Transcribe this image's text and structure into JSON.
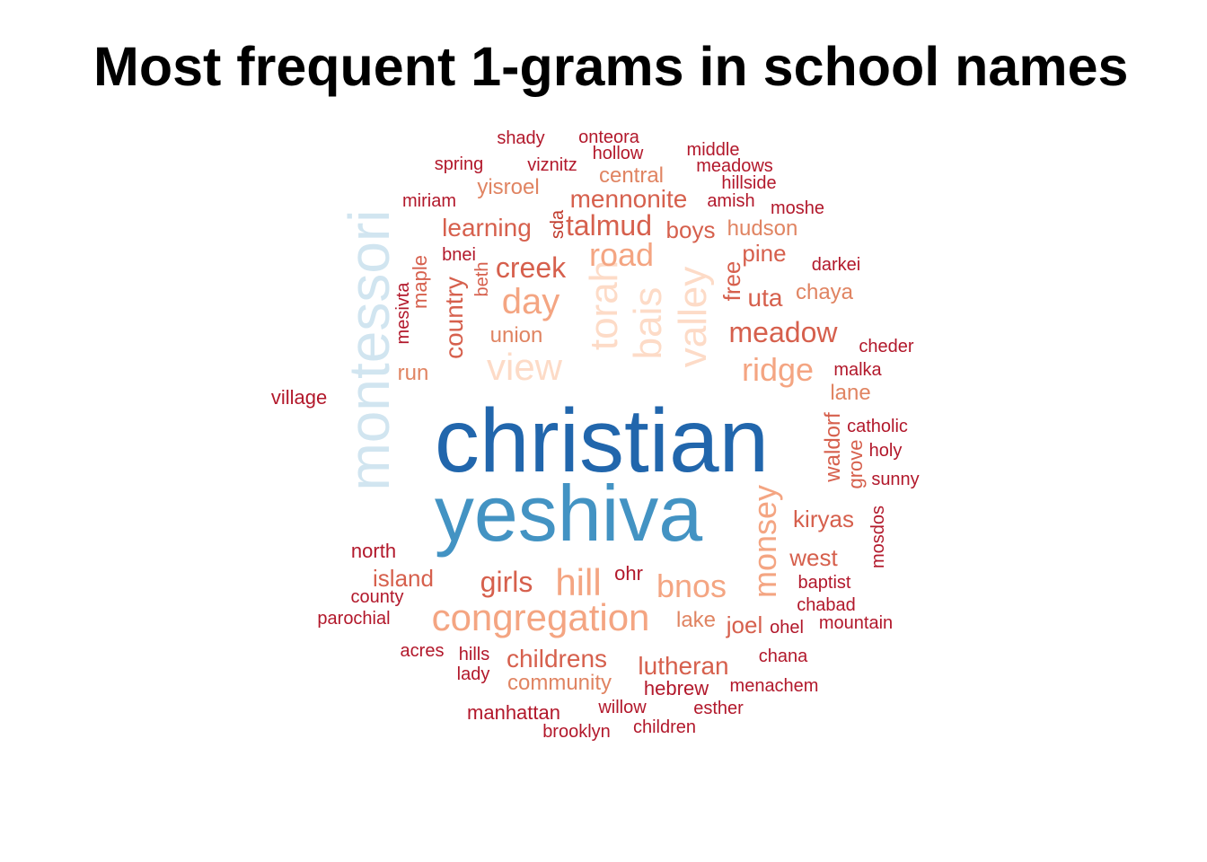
{
  "chart_data": {
    "type": "wordcloud",
    "title": "Most frequent 1-grams in school names",
    "color_scale": "RdBu (red = less frequent, blue = most frequent)",
    "words": [
      {
        "word": "christian",
        "color": "#2166ac"
      },
      {
        "word": "yeshiva",
        "color": "#4393c3"
      },
      {
        "word": "montessori",
        "color": "#d1e5f0"
      },
      {
        "word": "view",
        "color": "#fddbc7"
      },
      {
        "word": "torah",
        "color": "#fddbc7"
      },
      {
        "word": "bais",
        "color": "#fddbc7"
      },
      {
        "word": "valley",
        "color": "#fddbc7"
      },
      {
        "word": "congregation",
        "color": "#f4a582"
      },
      {
        "word": "hill",
        "color": "#f4a582"
      },
      {
        "word": "day",
        "color": "#f4a582"
      },
      {
        "word": "road",
        "color": "#f4a582"
      },
      {
        "word": "ridge",
        "color": "#f4a582"
      },
      {
        "word": "bnos",
        "color": "#f4a582"
      },
      {
        "word": "monsey",
        "color": "#f4a582"
      },
      {
        "word": "girls",
        "color": "#d6604d"
      },
      {
        "word": "creek",
        "color": "#d6604d"
      },
      {
        "word": "meadow",
        "color": "#d6604d"
      },
      {
        "word": "talmud",
        "color": "#d6604d"
      },
      {
        "word": "mennonite",
        "color": "#d6604d"
      },
      {
        "word": "learning",
        "color": "#d6604d"
      },
      {
        "word": "country",
        "color": "#d6604d"
      },
      {
        "word": "childrens",
        "color": "#d6604d"
      },
      {
        "word": "lutheran",
        "color": "#d6604d"
      },
      {
        "word": "uta",
        "color": "#d6604d"
      },
      {
        "word": "island",
        "color": "#d6604d"
      },
      {
        "word": "west",
        "color": "#d6604d"
      },
      {
        "word": "kiryas",
        "color": "#d6604d"
      },
      {
        "word": "joel",
        "color": "#d6604d"
      },
      {
        "word": "community",
        "color": "#e08462"
      },
      {
        "word": "waldorf",
        "color": "#d6604d"
      },
      {
        "word": "boys",
        "color": "#d6604d"
      },
      {
        "word": "free",
        "color": "#d6604d"
      },
      {
        "word": "pine",
        "color": "#d6604d"
      },
      {
        "word": "hudson",
        "color": "#e08462"
      },
      {
        "word": "central",
        "color": "#e08462"
      },
      {
        "word": "yisroel",
        "color": "#e08462"
      },
      {
        "word": "union",
        "color": "#e08462"
      },
      {
        "word": "chaya",
        "color": "#e08462"
      },
      {
        "word": "lane",
        "color": "#e08462"
      },
      {
        "word": "lake",
        "color": "#e08462"
      },
      {
        "word": "run",
        "color": "#e08462"
      },
      {
        "word": "grove",
        "color": "#d6604d"
      },
      {
        "word": "hebrew",
        "color": "#b2182b"
      },
      {
        "word": "maple",
        "color": "#d6604d"
      },
      {
        "word": "beth",
        "color": "#d6604d"
      },
      {
        "word": "sda",
        "color": "#c0392b"
      },
      {
        "word": "mesivta",
        "color": "#b2182b"
      },
      {
        "word": "bnei",
        "color": "#b2182b"
      },
      {
        "word": "ohr",
        "color": "#b2182b"
      },
      {
        "word": "ohel",
        "color": "#b2182b"
      },
      {
        "word": "village",
        "color": "#b2182b"
      },
      {
        "word": "north",
        "color": "#b2182b"
      },
      {
        "word": "county",
        "color": "#b2182b"
      },
      {
        "word": "parochial",
        "color": "#b2182b"
      },
      {
        "word": "acres",
        "color": "#b2182b"
      },
      {
        "word": "hills",
        "color": "#b2182b"
      },
      {
        "word": "lady",
        "color": "#b2182b"
      },
      {
        "word": "manhattan",
        "color": "#b2182b"
      },
      {
        "word": "brooklyn",
        "color": "#b2182b"
      },
      {
        "word": "willow",
        "color": "#b2182b"
      },
      {
        "word": "children",
        "color": "#b2182b"
      },
      {
        "word": "esther",
        "color": "#b2182b"
      },
      {
        "word": "menachem",
        "color": "#b2182b"
      },
      {
        "word": "chana",
        "color": "#b2182b"
      },
      {
        "word": "mountain",
        "color": "#b2182b"
      },
      {
        "word": "chabad",
        "color": "#b2182b"
      },
      {
        "word": "baptist",
        "color": "#b2182b"
      },
      {
        "word": "mosdos",
        "color": "#b2182b"
      },
      {
        "word": "sunny",
        "color": "#b2182b"
      },
      {
        "word": "holy",
        "color": "#b2182b"
      },
      {
        "word": "catholic",
        "color": "#b2182b"
      },
      {
        "word": "malka",
        "color": "#b2182b"
      },
      {
        "word": "cheder",
        "color": "#b2182b"
      },
      {
        "word": "darkei",
        "color": "#b2182b"
      },
      {
        "word": "moshe",
        "color": "#b2182b"
      },
      {
        "word": "amish",
        "color": "#b2182b"
      },
      {
        "word": "hillside",
        "color": "#b2182b"
      },
      {
        "word": "meadows",
        "color": "#b2182b"
      },
      {
        "word": "middle",
        "color": "#b2182b"
      },
      {
        "word": "hollow",
        "color": "#b2182b"
      },
      {
        "word": "onteora",
        "color": "#b2182b"
      },
      {
        "word": "shady",
        "color": "#b2182b"
      },
      {
        "word": "spring",
        "color": "#b2182b"
      },
      {
        "word": "viznitz",
        "color": "#b2182b"
      },
      {
        "word": "miriam",
        "color": "#b2182b"
      }
    ]
  }
}
